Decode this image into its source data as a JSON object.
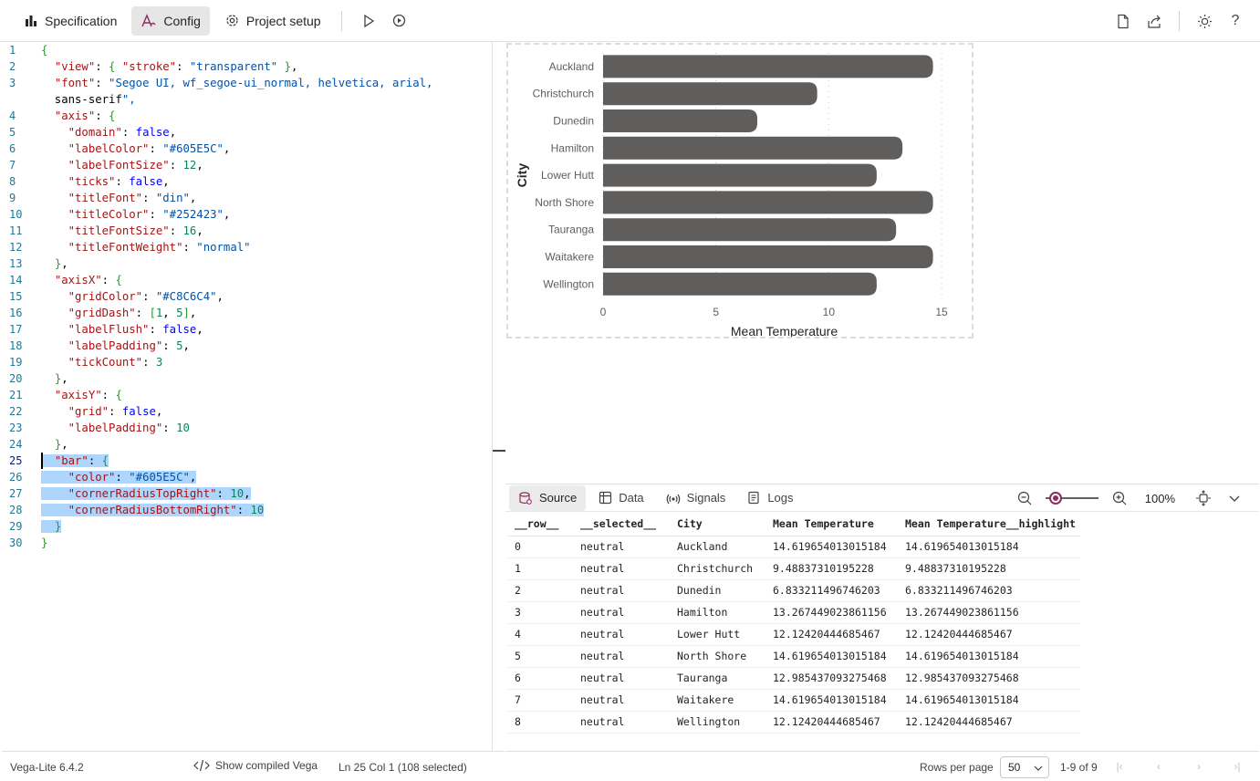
{
  "toolbar": {
    "specification": "Specification",
    "config": "Config",
    "project_setup": "Project setup"
  },
  "editor": {
    "lines": [
      "{",
      "  \"view\": { \"stroke\": \"transparent\" },",
      "  \"font\": \"Segoe UI, wf_segoe-ui_normal, helvetica, arial,",
      "  sans-serif\",",
      "  \"axis\": {",
      "    \"domain\": false,",
      "    \"labelColor\": \"#605E5C\",",
      "    \"labelFontSize\": 12,",
      "    \"ticks\": false,",
      "    \"titleFont\": \"din\",",
      "    \"titleColor\": \"#252423\",",
      "    \"titleFontSize\": 16,",
      "    \"titleFontWeight\": \"normal\"",
      "  },",
      "  \"axisX\": {",
      "    \"gridColor\": \"#C8C6C4\",",
      "    \"gridDash\": [1, 5],",
      "    \"labelFlush\": false,",
      "    \"labelPadding\": 5,",
      "    \"tickCount\": 3",
      "  },",
      "  \"axisY\": {",
      "    \"grid\": false,",
      "    \"labelPadding\": 10",
      "  },",
      "  \"bar\": {",
      "    \"color\": \"#605E5C\",",
      "    \"cornerRadiusTopRight\": 10,",
      "    \"cornerRadiusBottomRight\": 10",
      "  }",
      "}"
    ],
    "numbers": [
      "1",
      "2",
      "3",
      "",
      "4",
      "5",
      "6",
      "7",
      "8",
      "9",
      "10",
      "11",
      "12",
      "13",
      "14",
      "15",
      "16",
      "17",
      "18",
      "19",
      "20",
      "21",
      "22",
      "23",
      "24",
      "25",
      "26",
      "27",
      "28",
      "29",
      "30"
    ]
  },
  "chart_data": {
    "type": "bar",
    "orientation": "horizontal",
    "categories": [
      "Auckland",
      "Christchurch",
      "Dunedin",
      "Hamilton",
      "Lower Hutt",
      "North Shore",
      "Tauranga",
      "Waitakere",
      "Wellington"
    ],
    "values": [
      14.619654013015184,
      9.48837310195228,
      6.833211496746203,
      13.267449023861156,
      12.12420444685467,
      14.619654013015184,
      12.985437093275468,
      14.619654013015184,
      12.12420444685467
    ],
    "xlabel": "Mean Temperature",
    "ylabel": "City",
    "xlim": [
      0,
      15
    ],
    "xticks": [
      0,
      5,
      10,
      15
    ],
    "bar_color": "#605E5C",
    "grid": true,
    "grid_color": "#C8C6C4",
    "label_color": "#605E5C",
    "title_color": "#252423"
  },
  "panel": {
    "tabs": [
      "Source",
      "Data",
      "Signals",
      "Logs"
    ],
    "zoom": "100%",
    "columns": [
      "__row__",
      "__selected__",
      "City",
      "Mean Temperature",
      "Mean Temperature__highlight"
    ],
    "rows": [
      [
        "0",
        "neutral",
        "Auckland",
        "14.619654013015184",
        "14.619654013015184"
      ],
      [
        "1",
        "neutral",
        "Christchurch",
        "9.48837310195228",
        "9.48837310195228"
      ],
      [
        "2",
        "neutral",
        "Dunedin",
        "6.833211496746203",
        "6.833211496746203"
      ],
      [
        "3",
        "neutral",
        "Hamilton",
        "13.267449023861156",
        "13.267449023861156"
      ],
      [
        "4",
        "neutral",
        "Lower Hutt",
        "12.12420444685467",
        "12.12420444685467"
      ],
      [
        "5",
        "neutral",
        "North Shore",
        "14.619654013015184",
        "14.619654013015184"
      ],
      [
        "6",
        "neutral",
        "Tauranga",
        "12.985437093275468",
        "12.985437093275468"
      ],
      [
        "7",
        "neutral",
        "Waitakere",
        "14.619654013015184",
        "14.619654013015184"
      ],
      [
        "8",
        "neutral",
        "Wellington",
        "12.12420444685467",
        "12.12420444685467"
      ]
    ]
  },
  "status": {
    "version": "Vega-Lite 6.4.2",
    "show_compiled": "Show compiled Vega",
    "cursor": "Ln 25 Col 1 (108 selected)"
  },
  "pager": {
    "rows_per_page_label": "Rows per page",
    "rows_per_page": "50",
    "range": "1-9 of 9"
  },
  "colors": {
    "accent": "#8e2b63",
    "selection": "#add6ff"
  }
}
